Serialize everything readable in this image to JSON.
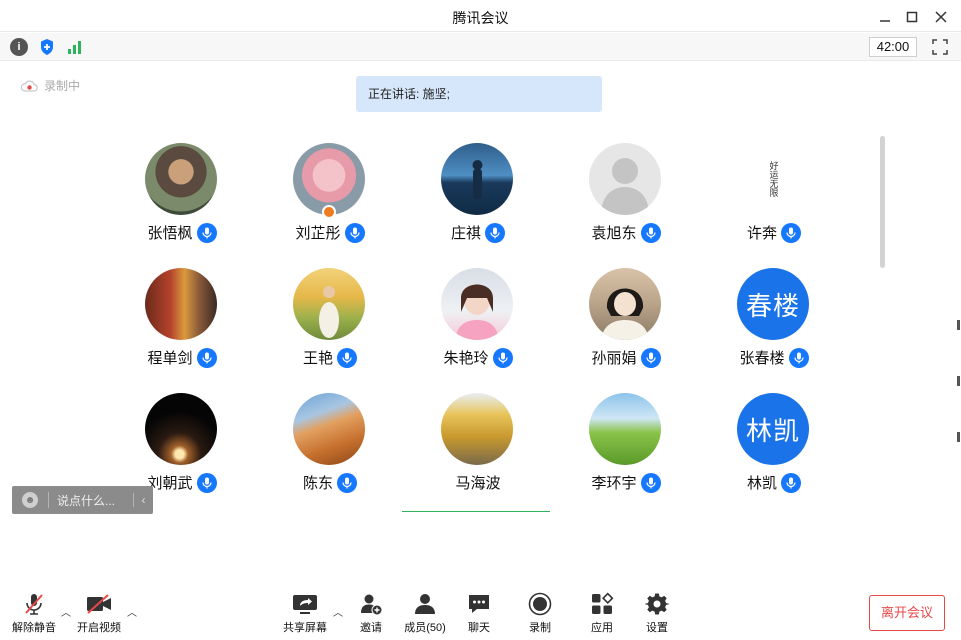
{
  "window": {
    "title": "腾讯会议"
  },
  "infobar": {
    "timer": "42:00"
  },
  "recording": {
    "label": "录制中"
  },
  "speaking": {
    "text": "正在讲话: 施坚;"
  },
  "participants": [
    {
      "name": "张悟枫"
    },
    {
      "name": "刘芷彤"
    },
    {
      "name": "庄祺"
    },
    {
      "name": "袁旭东"
    },
    {
      "name": "许奔",
      "avatar_text": "好运无限"
    },
    {
      "name": "程单剑"
    },
    {
      "name": "王艳"
    },
    {
      "name": "朱艳玲"
    },
    {
      "name": "孙丽娟"
    },
    {
      "name": "张春楼",
      "avatar_text": "春楼"
    },
    {
      "name": "刘朝武"
    },
    {
      "name": "陈东"
    },
    {
      "name": "马海波"
    },
    {
      "name": "李环宇"
    },
    {
      "name": "林凯",
      "avatar_text": "林凯"
    }
  ],
  "chat": {
    "placeholder": "说点什么..."
  },
  "toolbar": {
    "unmute": "解除静音",
    "start_video": "开启视频",
    "share_screen": "共享屏幕",
    "invite": "邀请",
    "members": "成员(50)",
    "chat": "聊天",
    "record": "录制",
    "apps": "应用",
    "settings": "设置",
    "leave": "离开会议"
  },
  "colors": {
    "accent": "#1677ff",
    "speaking_bg": "#d7e7fb",
    "leave": "#e84848"
  }
}
